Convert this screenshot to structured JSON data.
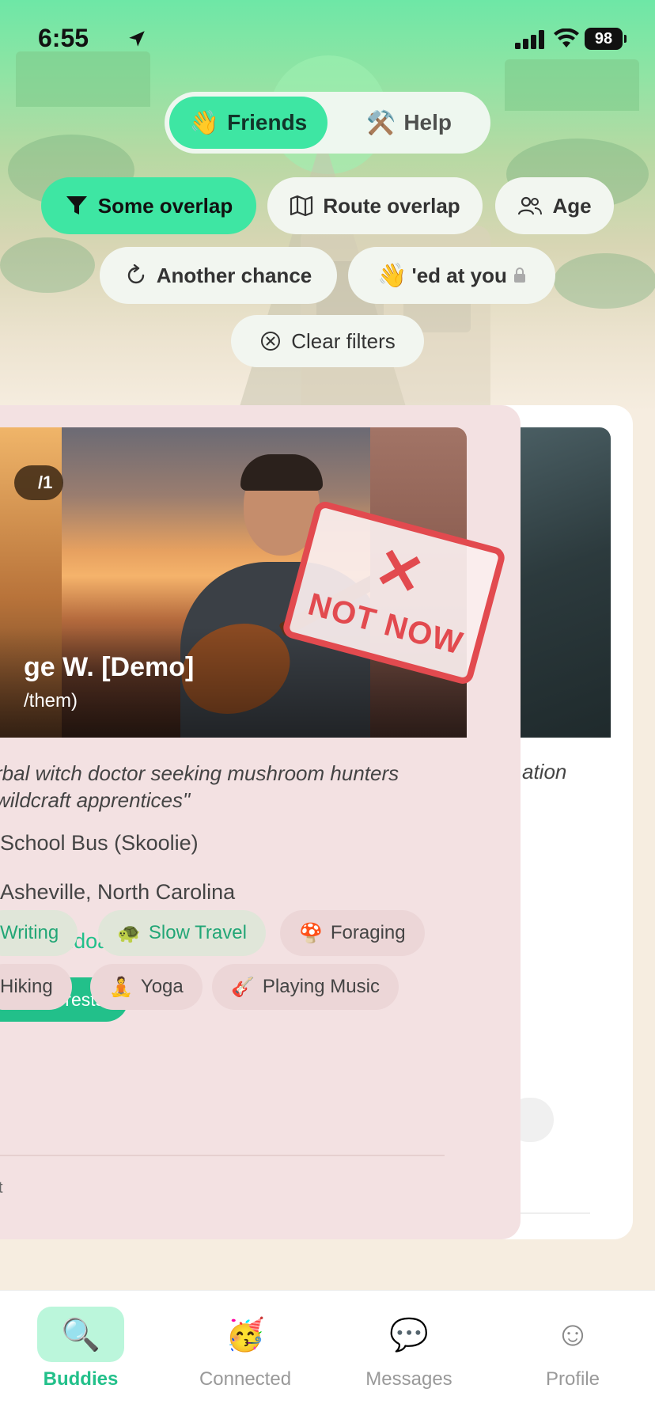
{
  "status_bar": {
    "time": "6:55",
    "battery": "98"
  },
  "mode_switch": {
    "friends": {
      "emoji": "👋",
      "label": "Friends"
    },
    "help": {
      "emoji": "⚒️",
      "label": "Help"
    }
  },
  "filters": {
    "some_overlap": "Some overlap",
    "route_overlap": "Route overlap",
    "age": "Age",
    "another_chance": "Another chance",
    "waved_emoji": "👋",
    "waved": "'ed at you",
    "clear": "Clear filters"
  },
  "profile_card": {
    "photo_counter": "/1",
    "name": "ge W. [Demo]",
    "pronouns": "/them)",
    "stamp_mark": "✕",
    "stamp_label": "NOT NOW",
    "quote": "rbal witch doctor seeking mushroom hunters\nwildcraft apprentices\"",
    "vehicle": "School Bus (Skoolie)",
    "home": "Asheville, North Carolina",
    "route": "Shenandoah, VA",
    "shared_interests_label": "hared interests",
    "interests": [
      {
        "emoji": "",
        "label": "Writing",
        "shared": true
      },
      {
        "emoji": "🐢",
        "label": "Slow Travel",
        "shared": true
      },
      {
        "emoji": "🍄",
        "label": "Foraging",
        "shared": false
      },
      {
        "emoji": "",
        "label": "Hiking",
        "shared": false
      },
      {
        "emoji": "🧘",
        "label": "Yoga",
        "shared": false
      },
      {
        "emoji": "🎸",
        "label": "Playing Music",
        "shared": false
      }
    ],
    "footer_fragment": "t"
  },
  "next_card": {
    "quote_fragment": "ation"
  },
  "tab_bar": [
    {
      "icon": "🔍",
      "label": "Buddies",
      "active": true
    },
    {
      "icon": "🥳",
      "label": "Connected",
      "active": false
    },
    {
      "icon": "💬",
      "label": "Messages",
      "active": false
    },
    {
      "icon": "☺",
      "label": "Profile",
      "active": false
    }
  ],
  "colors": {
    "accent": "#3ee6a3",
    "green_text": "#22c08a",
    "reject": "#e24a4f",
    "card_bg": "#f3e1e2"
  }
}
